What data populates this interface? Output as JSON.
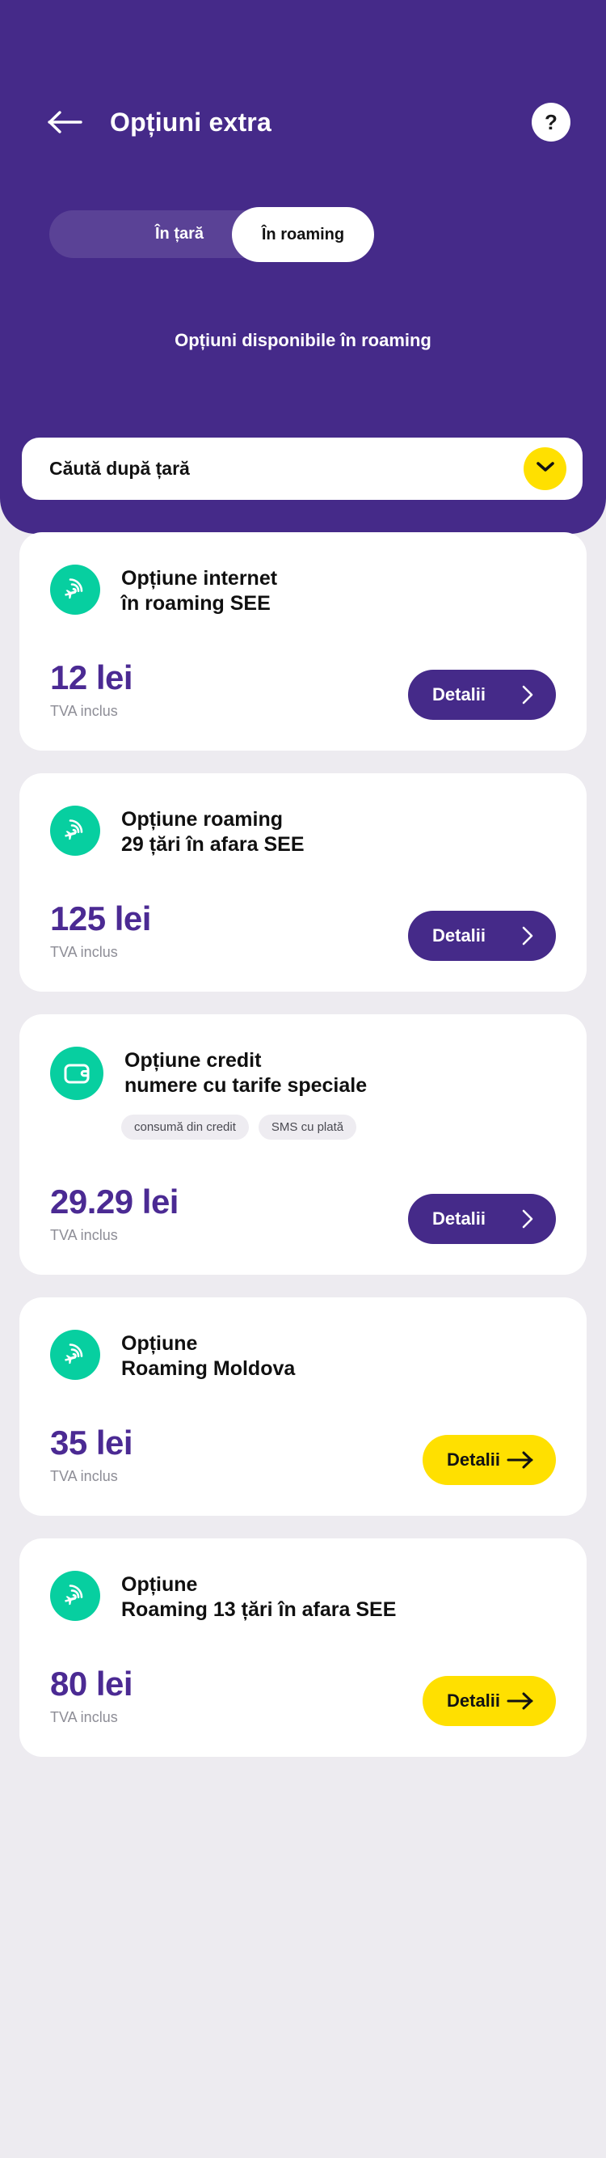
{
  "colors": {
    "brand_purple": "#452a89",
    "accent_yellow": "#ffe000",
    "icon_teal": "#07cfa0",
    "price_purple": "#4b2a93",
    "page_bg": "#edebf0"
  },
  "header": {
    "back_icon": "arrow-left-icon",
    "title": "Opțiuni extra",
    "help_label": "?"
  },
  "tabs": [
    {
      "label": "În țară",
      "active": false
    },
    {
      "label": "În roaming",
      "active": true
    }
  ],
  "subtitle": "Opțiuni disponibile în roaming",
  "country_select": {
    "label": "Căută după țară",
    "chevron_icon": "chevron-down-icon"
  },
  "vat_note": "TVA inclus",
  "cards": [
    {
      "icon": "roaming-plane-signal-icon",
      "title": "Opțiune internet\nîn roaming SEE",
      "tags": [],
      "price": "12 lei",
      "vat": "TVA inclus",
      "button": {
        "label": "Detalii",
        "style": "purple",
        "arrow": "chevron-right-icon"
      }
    },
    {
      "icon": "roaming-plane-signal-icon",
      "title": "Opțiune roaming\n29 țări în afara SEE",
      "tags": [],
      "price": "125 lei",
      "vat": "TVA inclus",
      "button": {
        "label": "Detalii",
        "style": "purple",
        "arrow": "chevron-right-icon"
      }
    },
    {
      "icon": "wallet-icon",
      "title": "Opțiune credit\nnumere cu tarife speciale",
      "tags": [
        "consumă din credit",
        "SMS cu plată"
      ],
      "price": "29.29 lei",
      "vat": "TVA inclus",
      "button": {
        "label": "Detalii",
        "style": "purple",
        "arrow": "chevron-right-icon"
      }
    },
    {
      "icon": "roaming-plane-signal-icon",
      "title": "Opțiune\nRoaming Moldova",
      "tags": [],
      "price": "35 lei",
      "vat": "TVA inclus",
      "button": {
        "label": "Detalii",
        "style": "yellow",
        "arrow": "arrow-right-icon"
      }
    },
    {
      "icon": "roaming-plane-signal-icon",
      "title": "Opțiune\nRoaming 13 țări în afara SEE",
      "tags": [],
      "price": "80 lei",
      "vat": "TVA inclus",
      "button": {
        "label": "Detalii",
        "style": "yellow",
        "arrow": "arrow-right-icon"
      }
    }
  ]
}
